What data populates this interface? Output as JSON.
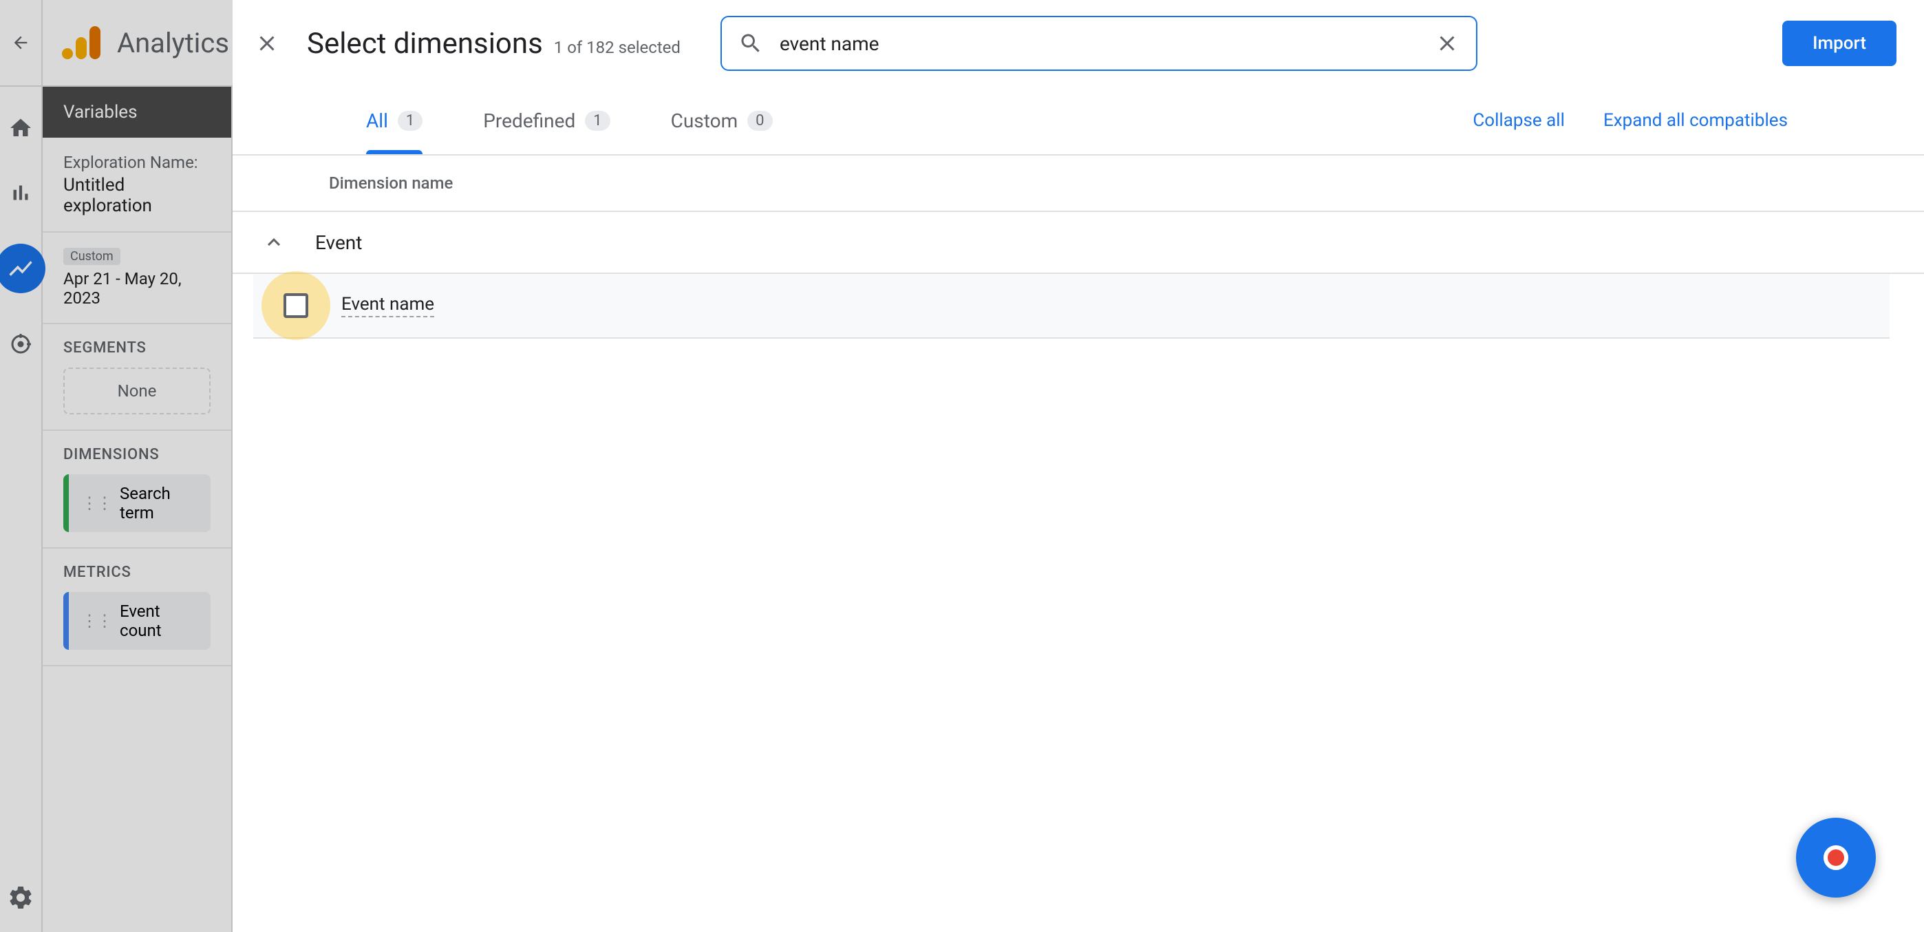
{
  "app": {
    "title": "Analytics"
  },
  "sidebar": {
    "variables_header": "Variables",
    "exploration_label": "Exploration Name:",
    "exploration_name": "Untitled exploration",
    "date_badge": "Custom",
    "date_range": "Apr 21 - May 20, 2023",
    "segments_label": "SEGMENTS",
    "segments_empty": "None",
    "dimensions_label": "DIMENSIONS",
    "dimension_items": [
      {
        "label": "Search term"
      }
    ],
    "metrics_label": "METRICS",
    "metric_items": [
      {
        "label": "Event count"
      }
    ]
  },
  "modal": {
    "title": "Select dimensions",
    "subtitle": "1 of 182 selected",
    "search_value": "event name",
    "import_button": "Import",
    "tabs": {
      "all": {
        "label": "All",
        "count": "1"
      },
      "predefined": {
        "label": "Predefined",
        "count": "1"
      },
      "custom": {
        "label": "Custom",
        "count": "0"
      }
    },
    "collapse_all": "Collapse all",
    "expand_all": "Expand all compatibles",
    "column_header": "Dimension name",
    "groups": [
      {
        "name": "Event",
        "expanded": true,
        "items": [
          {
            "label": "Event name",
            "checked": false
          }
        ]
      }
    ]
  }
}
